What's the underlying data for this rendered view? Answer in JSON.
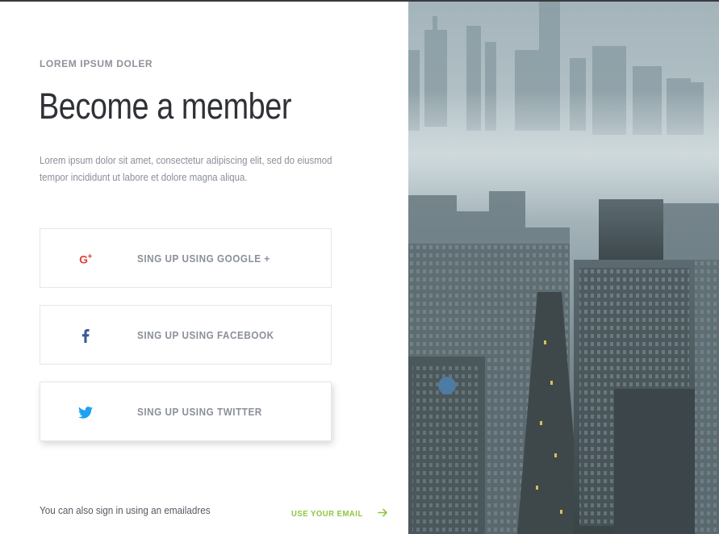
{
  "eyebrow": "LOREM IPSUM DOLER",
  "title": "Become a member",
  "description": "Lorem ipsum dolor sit amet, consectetur adipiscing elit, sed do eiusmod\ntempor incididunt ut labore et dolore magna aliqua.",
  "buttons": {
    "google": {
      "label": "SING UP USING GOOGLE +",
      "icon": "google-plus-icon",
      "color": "#db4437"
    },
    "facebook": {
      "label": "SING UP USING FACEBOOK",
      "icon": "facebook-icon",
      "color": "#3b5998"
    },
    "twitter": {
      "label": "SING UP USING TWITTER",
      "icon": "twitter-icon",
      "color": "#1da1f2"
    }
  },
  "footer": {
    "text": "You can also sign in using an emailadres",
    "link_label": "USE YOUR EMAIL",
    "link_icon": "arrow-right-icon",
    "link_color": "#8dc63f"
  },
  "hero_image": {
    "subject": "foggy-city-skyline"
  }
}
